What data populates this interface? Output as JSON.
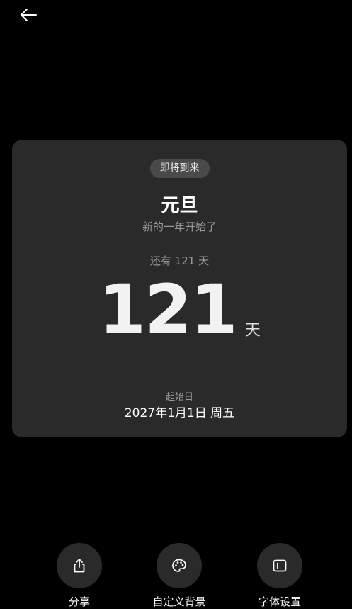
{
  "header": {
    "back_icon": "arrow-left-icon"
  },
  "card": {
    "status_label": "即将到来",
    "title": "元旦",
    "subtitle": "新的一年开始了",
    "remaining_text": "还有 121 天",
    "days_count": "121",
    "days_unit": "天",
    "start_label": "起始日",
    "start_date": "2027年1月1日 周五"
  },
  "actions": [
    {
      "label": "分享",
      "icon": "share-icon"
    },
    {
      "label": "自定义背景",
      "icon": "palette-icon"
    },
    {
      "label": "字体设置",
      "icon": "text-box-icon"
    }
  ],
  "colors": {
    "background": "#000000",
    "card": "#2a2a2a",
    "pill": "#4a4a4a",
    "muted_text": "#9a9a9a",
    "primary_text": "#ffffff"
  }
}
